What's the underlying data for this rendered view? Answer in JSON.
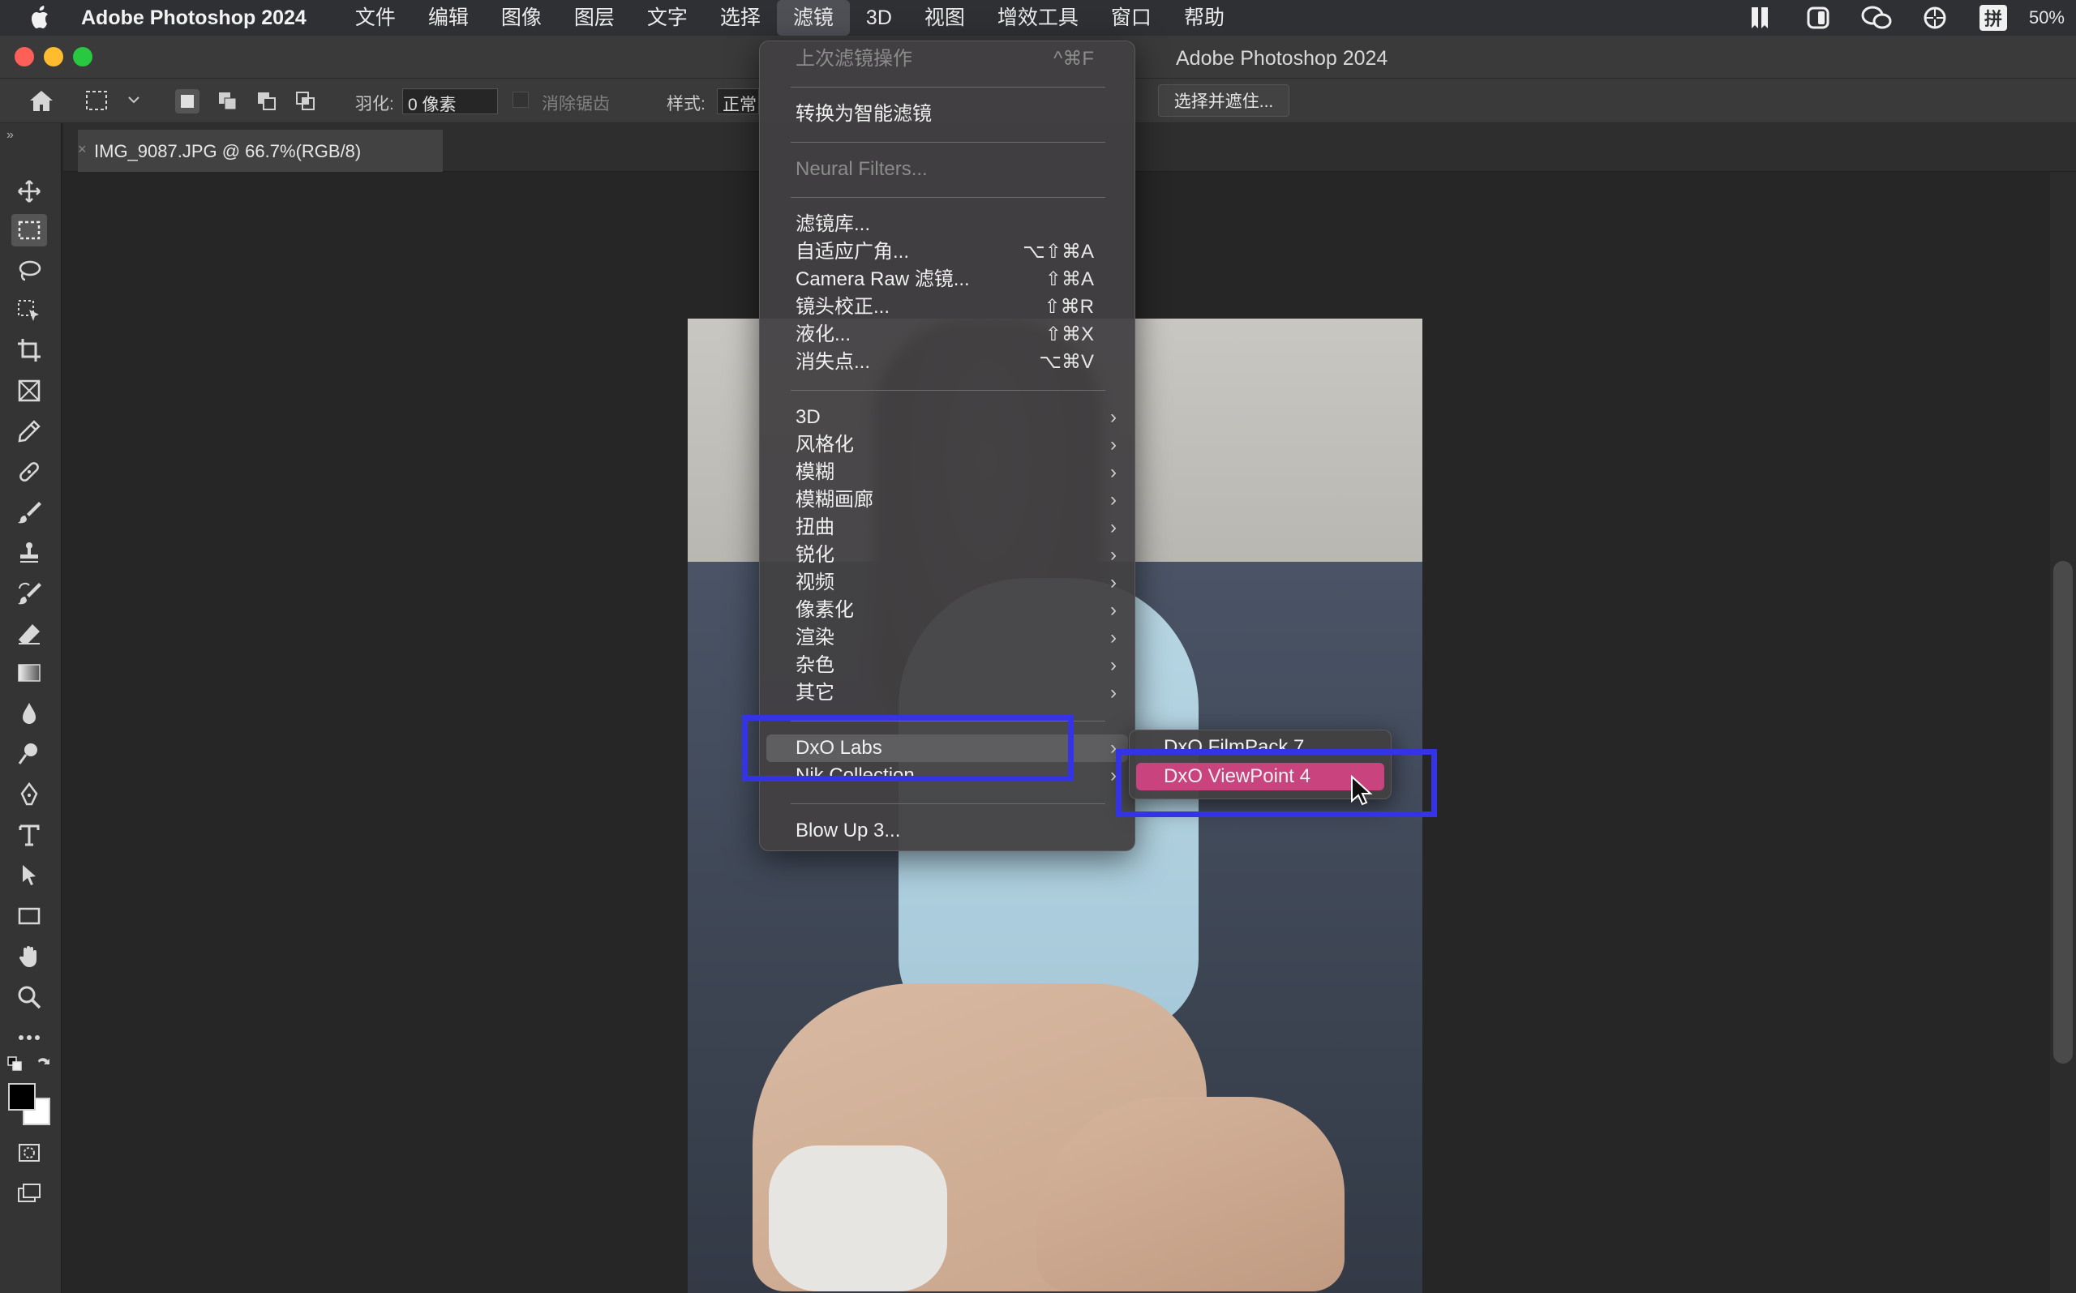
{
  "menubar": {
    "app_name": "Adobe Photoshop 2024",
    "menus": [
      "文件",
      "编辑",
      "图像",
      "图层",
      "文字",
      "选择",
      "滤镜",
      "3D",
      "视图",
      "增效工具",
      "窗口",
      "帮助"
    ],
    "active_menu": "滤镜",
    "battery": "50%",
    "ime_label": "拼"
  },
  "window": {
    "title": "Adobe Photoshop 2024"
  },
  "options": {
    "feather_label": "羽化:",
    "feather_value": "0 像素",
    "antialias_label": "消除锯齿",
    "style_label": "样式:",
    "style_value": "正常",
    "select_mask_label": "选择并遮住..."
  },
  "document": {
    "tab_label": "IMG_9087.JPG @ 66.7%(RGB/8)"
  },
  "filter_menu": {
    "last_filter": {
      "label": "上次滤镜操作",
      "shortcut": "^⌘F"
    },
    "convert_smart": "转换为智能滤镜",
    "neural": "Neural Filters...",
    "group_main": [
      {
        "label": "滤镜库...",
        "shortcut": ""
      },
      {
        "label": "自适应广角...",
        "shortcut": "⌥⇧⌘A"
      },
      {
        "label": "Camera Raw 滤镜...",
        "shortcut": "⇧⌘A"
      },
      {
        "label": "镜头校正...",
        "shortcut": "⇧⌘R"
      },
      {
        "label": "液化...",
        "shortcut": "⇧⌘X"
      },
      {
        "label": "消失点...",
        "shortcut": "⌥⌘V"
      }
    ],
    "group_sub": [
      "3D",
      "风格化",
      "模糊",
      "模糊画廊",
      "扭曲",
      "锐化",
      "视频",
      "像素化",
      "渲染",
      "杂色",
      "其它"
    ],
    "dxo": "DxO Labs",
    "nik": "Nik Collection",
    "blowup": "Blow Up 3..."
  },
  "submenu": {
    "items": [
      "DxO FilmPack 7",
      "DxO ViewPoint 4"
    ],
    "highlight_color": "#c9447f"
  },
  "colors": {
    "annotation": "#3533e6",
    "menu_bg": "#424042"
  }
}
